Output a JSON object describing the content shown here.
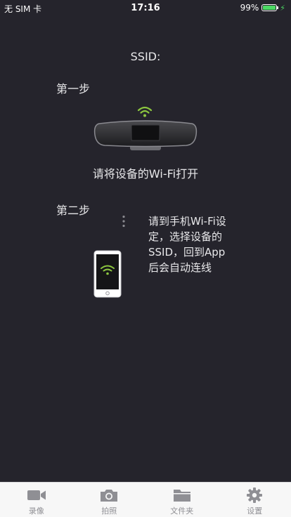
{
  "status_bar": {
    "carrier": "无 SIM 卡",
    "time": "17:16",
    "battery_percent_text": "99%",
    "battery_level": 0.99,
    "battery_color": "#4cd964"
  },
  "main": {
    "ssid_label": "SSID:",
    "step1": {
      "title": "第一步",
      "caption": "请将设备的Wi-Fi打开"
    },
    "step2": {
      "title": "第二步",
      "caption_lines": [
        "请到手机Wi-Fi设",
        "定，选择设备的",
        "SSID，回到App",
        "后会自动连线"
      ]
    },
    "wifi_color": "#8cc63f"
  },
  "tab_bar": {
    "tabs": [
      {
        "label": "录像",
        "icon": "video-camera-icon"
      },
      {
        "label": "拍照",
        "icon": "camera-icon"
      },
      {
        "label": "文件夹",
        "icon": "folder-icon"
      },
      {
        "label": "设置",
        "icon": "gear-icon"
      }
    ]
  }
}
